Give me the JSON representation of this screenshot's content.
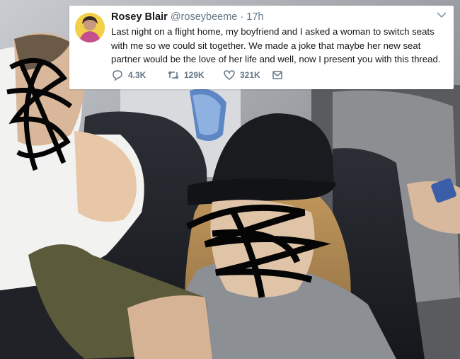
{
  "tweet": {
    "display_name": "Rosey Blair",
    "handle": "@roseybeeme",
    "separator": "·",
    "time": "17h",
    "text": "Last night on a flight home, my boyfriend and I asked a woman to switch seats with me so we could sit together. We made a joke that maybe her new seat partner would be the love of her life and well, now I present you with this thread.",
    "replies": "4.3K",
    "retweets": "129K",
    "likes": "321K"
  },
  "icons": {
    "reply": "reply-icon",
    "retweet": "retweet-icon",
    "like": "heart-icon",
    "message": "message-icon",
    "more": "chevron-down-icon"
  },
  "colors": {
    "accent_text": "#657786",
    "primary_text": "#14171a",
    "card_bg": "#ffffff"
  }
}
